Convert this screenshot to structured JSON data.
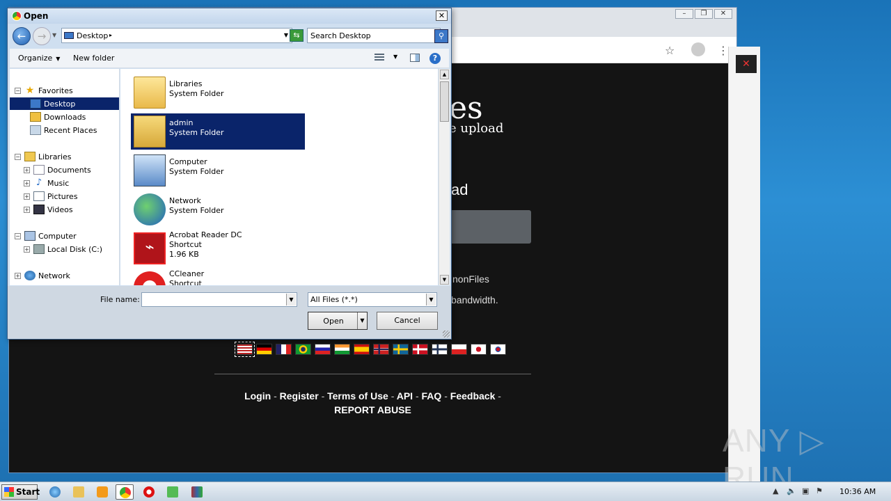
{
  "chrome": {
    "window_buttons": [
      "–",
      "❐",
      "✕"
    ],
    "toolbar_icons": [
      "star-icon",
      "profile-icon",
      "menu-icon"
    ]
  },
  "website": {
    "title_fragment": "es",
    "subtitle_fragment": "e upload",
    "heading_fragment": "ad",
    "line1": "nonFiles",
    "line2": "bandwidth.",
    "footer_links": [
      "Login",
      "Register",
      "Terms of Use",
      "API",
      "FAQ",
      "Feedback"
    ],
    "footer_sep": "-",
    "report_abuse": "REPORT ABUSE",
    "flags": [
      "us",
      "de",
      "fr",
      "br",
      "ru",
      "in",
      "es",
      "no",
      "se",
      "dk",
      "fi",
      "pl",
      "jp",
      "kr"
    ]
  },
  "dialog": {
    "title": "Open",
    "close_glyph": "✕",
    "address": "Desktop",
    "search_placeholder": "Search Desktop",
    "toolbar": {
      "organize": "Organize",
      "new_folder": "New folder",
      "help": "?"
    },
    "tree": {
      "favorites": "Favorites",
      "desktop": "Desktop",
      "downloads": "Downloads",
      "recent_places": "Recent Places",
      "libraries": "Libraries",
      "documents": "Documents",
      "music": "Music",
      "pictures": "Pictures",
      "videos": "Videos",
      "computer": "Computer",
      "local_disk": "Local Disk (C:)",
      "network": "Network"
    },
    "files": [
      {
        "name": "Libraries",
        "type": "System Folder",
        "size": ""
      },
      {
        "name": "admin",
        "type": "System Folder",
        "size": ""
      },
      {
        "name": "Computer",
        "type": "System Folder",
        "size": ""
      },
      {
        "name": "Network",
        "type": "System Folder",
        "size": ""
      },
      {
        "name": "Acrobat Reader DC",
        "type": "Shortcut",
        "size": "1.96 KB"
      },
      {
        "name": "CCleaner",
        "type": "Shortcut",
        "size": ""
      }
    ],
    "file_name_label": "File name:",
    "file_name_value": "",
    "file_type": "All Files (*.*)",
    "open_label": "Open",
    "cancel_label": "Cancel"
  },
  "taskbar": {
    "start_label": "Start",
    "clock": "10:36 AM"
  },
  "watermark": "ANY ▷ RUN",
  "colors": {
    "selection": "#0a246a",
    "desktop_blue": "#1a73b8",
    "site_bg": "#141414"
  }
}
